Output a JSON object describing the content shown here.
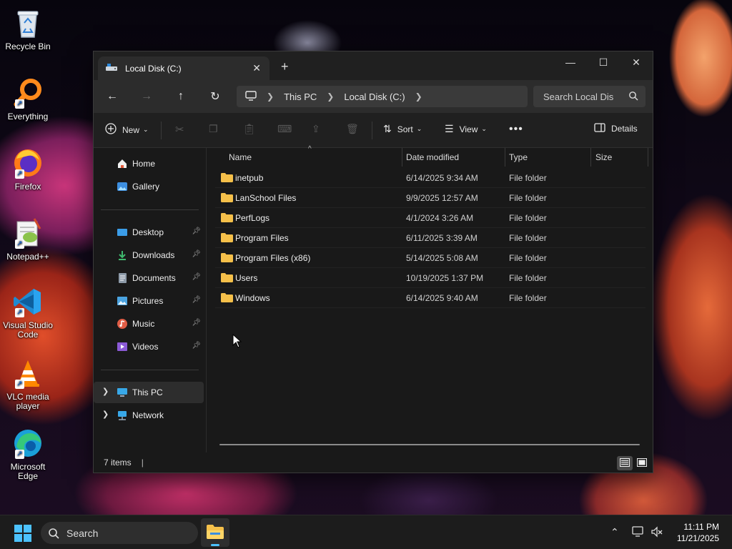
{
  "desktop": {
    "icons": [
      {
        "label": "Recycle Bin",
        "icon": "recycle-bin-icon"
      },
      {
        "label": "Everything",
        "icon": "everything-icon"
      },
      {
        "label": "Firefox",
        "icon": "firefox-icon"
      },
      {
        "label": "Notepad++",
        "icon": "notepad-plus-plus-icon"
      },
      {
        "label": "Visual Studio Code",
        "icon": "vscode-icon"
      },
      {
        "label": "VLC media player",
        "icon": "vlc-icon"
      },
      {
        "label": "Microsoft Edge",
        "icon": "edge-icon"
      }
    ]
  },
  "window": {
    "tab_title": "Local Disk (C:)",
    "new_tab": "+",
    "controls": {
      "minimize": "—",
      "maximize": "☐",
      "close": "✕"
    }
  },
  "navbar": {
    "breadcrumb": [
      "This PC",
      "Local Disk (C:)"
    ],
    "search_placeholder": "Search Local Dis"
  },
  "toolbar": {
    "new_label": "New",
    "sort_label": "Sort",
    "view_label": "View",
    "details_label": "Details"
  },
  "navpane": {
    "top": [
      {
        "label": "Home",
        "icon": "home-icon"
      },
      {
        "label": "Gallery",
        "icon": "gallery-icon"
      }
    ],
    "quick_access": [
      {
        "label": "Desktop",
        "icon": "desktop-folder-icon",
        "color": "#3b9de8"
      },
      {
        "label": "Downloads",
        "icon": "downloads-icon",
        "color": "#3fb96e"
      },
      {
        "label": "Documents",
        "icon": "documents-icon",
        "color": "#8d9aa8"
      },
      {
        "label": "Pictures",
        "icon": "pictures-icon",
        "color": "#4aa3e0"
      },
      {
        "label": "Music",
        "icon": "music-icon",
        "color": "#e05d46"
      },
      {
        "label": "Videos",
        "icon": "videos-icon",
        "color": "#8b5ad6"
      }
    ],
    "this_pc": "This PC",
    "network": "Network"
  },
  "table": {
    "columns": [
      "Name",
      "Date modified",
      "Type",
      "Size"
    ],
    "rows": [
      {
        "name": "inetpub",
        "date": "6/14/2025 9:34 AM",
        "type": "File folder"
      },
      {
        "name": "LanSchool Files",
        "date": "9/9/2025 12:57 AM",
        "type": "File folder"
      },
      {
        "name": "PerfLogs",
        "date": "4/1/2024 3:26 AM",
        "type": "File folder"
      },
      {
        "name": "Program Files",
        "date": "6/11/2025 3:39 AM",
        "type": "File folder"
      },
      {
        "name": "Program Files (x86)",
        "date": "5/14/2025 5:08 AM",
        "type": "File folder"
      },
      {
        "name": "Users",
        "date": "10/19/2025 1:37 PM",
        "type": "File folder"
      },
      {
        "name": "Windows",
        "date": "6/14/2025 9:40 AM",
        "type": "File folder"
      }
    ]
  },
  "status": {
    "item_count": "7 items"
  },
  "taskbar": {
    "search_label": "Search",
    "time": "11:11 PM",
    "date": "11/21/2025"
  },
  "colors": {
    "folder": "#f5c04a",
    "accent": "#4cc2ff",
    "window_bg": "#191919"
  }
}
